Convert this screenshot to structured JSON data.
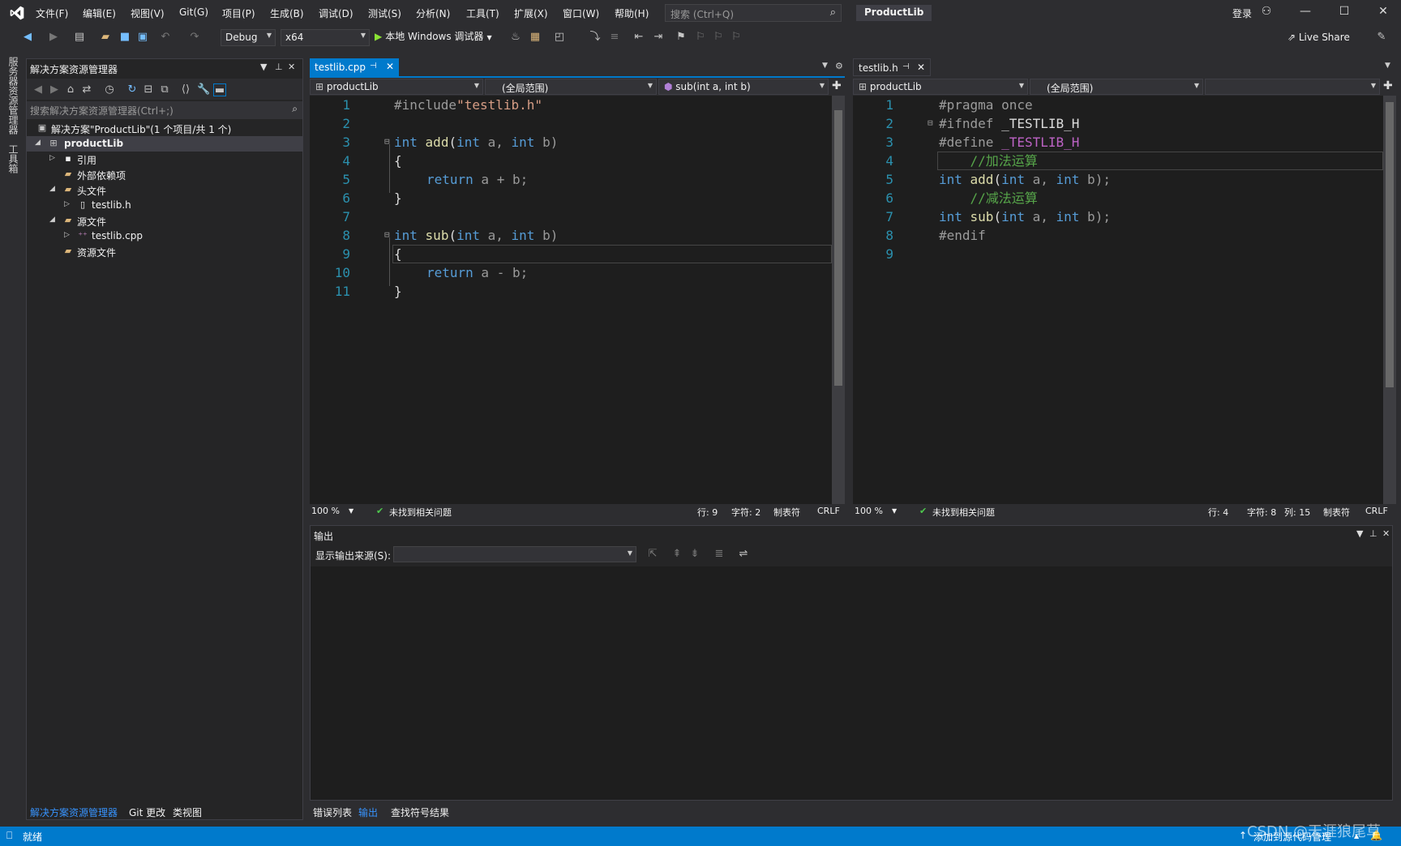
{
  "menu": {
    "items": [
      "文件(F)",
      "编辑(E)",
      "视图(V)",
      "Git(G)",
      "项目(P)",
      "生成(B)",
      "调试(D)",
      "测试(S)",
      "分析(N)",
      "工具(T)",
      "扩展(X)",
      "窗口(W)",
      "帮助(H)"
    ],
    "search_placeholder": "搜索 (Ctrl+Q)",
    "project_title": "ProductLib",
    "signin": "登录"
  },
  "toolbar": {
    "config": "Debug",
    "platform": "x64",
    "run_label": "本地 Windows 调试器",
    "live_share": "Live Share"
  },
  "vtabs": {
    "server_explorer": "服务器资源管理器",
    "toolbox": "工具箱"
  },
  "solution_explorer": {
    "title": "解决方案资源管理器",
    "search_placeholder": "搜索解决方案资源管理器(Ctrl+;)",
    "tree": {
      "solution": "解决方案\"ProductLib\"(1 个项目/共 1 个)",
      "project": "productLib",
      "references": "引用",
      "external_deps": "外部依赖项",
      "header_files": "头文件",
      "testlib_h": "testlib.h",
      "source_files": "源文件",
      "testlib_cpp": "testlib.cpp",
      "resource_files": "资源文件"
    },
    "bottom_tabs": [
      "解决方案资源管理器",
      "Git 更改",
      "类视图"
    ]
  },
  "editor_left": {
    "tab": "testlib.cpp",
    "nav": {
      "project": "productLib",
      "scope": "(全局范围)",
      "member": "sub(int a, int b)"
    },
    "line_numbers": [
      "1",
      "2",
      "3",
      "4",
      "5",
      "6",
      "7",
      "8",
      "9",
      "10",
      "11"
    ],
    "code": {
      "l1_pp": "#include",
      "l1_str": "\"testlib.h\"",
      "l3_kw1": "int",
      "l3_fn": "add",
      "l3_p1": "(",
      "l3_kw2": "int",
      "l3_a": " a, ",
      "l3_kw3": "int",
      "l3_b": " b)",
      "l4": "{",
      "l5_kw": "return",
      "l5_rest": " a + b;",
      "l6": "}",
      "l8_kw1": "int",
      "l8_fn": "sub",
      "l8_p1": "(",
      "l8_kw2": "int",
      "l8_a": " a, ",
      "l8_kw3": "int",
      "l8_b": " b)",
      "l9": "{",
      "l10_kw": "return",
      "l10_rest": " a - b;",
      "l11": "}"
    },
    "status": {
      "zoom": "100 %",
      "issues": "未找到相关问题",
      "line": "行: 9",
      "char": "字符: 2",
      "tabs": "制表符",
      "eol": "CRLF"
    }
  },
  "editor_right": {
    "tab": "testlib.h",
    "nav": {
      "project": "productLib",
      "scope": "(全局范围)"
    },
    "line_numbers": [
      "1",
      "2",
      "3",
      "4",
      "5",
      "6",
      "7",
      "8",
      "9"
    ],
    "code": {
      "l1": "#pragma once",
      "l2_pp": "#ifndef",
      "l2_mac": " _TESTLIB_H",
      "l3_pp": "#define",
      "l3_mac": " _TESTLIB_H",
      "l4": "    //加法运算",
      "l5_kw1": "int",
      "l5_fn": " add",
      "l5_p": "(",
      "l5_kw2": "int",
      "l5_a": " a, ",
      "l5_kw3": "int",
      "l5_b": " b);",
      "l6": "    //减法运算",
      "l7_kw1": "int",
      "l7_fn": " sub",
      "l7_p": "(",
      "l7_kw2": "int",
      "l7_a": " a, ",
      "l7_kw3": "int",
      "l7_b": " b);",
      "l8": "#endif"
    },
    "status": {
      "zoom": "100 %",
      "issues": "未找到相关问题",
      "line": "行: 4",
      "char": "字符: 8",
      "col": "列: 15",
      "tabs": "制表符",
      "eol": "CRLF"
    }
  },
  "output": {
    "title": "输出",
    "source_label": "显示输出来源(S):",
    "tabs": [
      "错误列表",
      "输出",
      "查找符号结果"
    ]
  },
  "statusbar": {
    "ready": "就绪",
    "source_control": "添加到源代码管理"
  },
  "watermark": "CSDN @天涯狼尾草",
  "colors": {
    "accent": "#007acc",
    "keyword": "#569cd6",
    "comment": "#57a64a",
    "string": "#d69d85"
  }
}
